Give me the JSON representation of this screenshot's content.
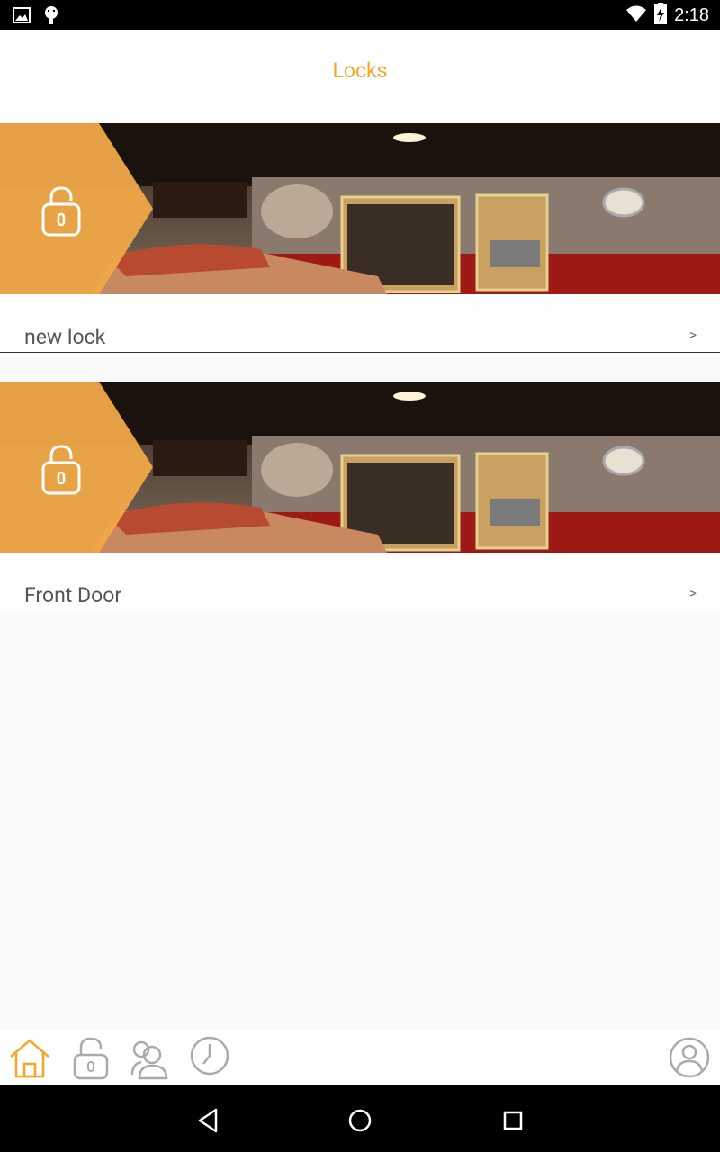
{
  "status_bar": {
    "time": "2:18",
    "left_icons": [
      "image-icon",
      "android-debug-icon"
    ],
    "right_icons": [
      "wifi-icon",
      "battery-charging-icon"
    ]
  },
  "header": {
    "title": "Locks",
    "title_color": "#f5a623"
  },
  "locks": [
    {
      "name": "new lock",
      "chevron": ">",
      "icon": "unlocked-padlock-icon"
    },
    {
      "name": "Front Door",
      "chevron": ">",
      "icon": "unlocked-padlock-icon"
    }
  ],
  "bottom_nav": {
    "items": [
      {
        "icon": "home-icon",
        "active": true
      },
      {
        "icon": "lock-icon",
        "active": false
      },
      {
        "icon": "users-icon",
        "active": false
      },
      {
        "icon": "clock-icon",
        "active": false
      },
      {
        "icon": "profile-icon",
        "active": false
      }
    ]
  },
  "system_nav": [
    "back-icon",
    "home-circle-icon",
    "recents-icon"
  ],
  "colors": {
    "accent": "#f5a623",
    "banner_overlay": "#f0a848",
    "nav_inactive": "#aaaaaa"
  }
}
